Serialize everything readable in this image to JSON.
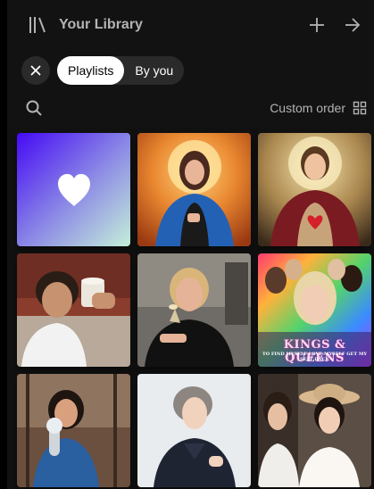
{
  "header": {
    "title": "Your Library",
    "library_icon": "library-icon",
    "create_icon": "plus-icon",
    "expand_icon": "arrow-right-icon"
  },
  "filters": {
    "clear_icon": "close-icon",
    "chips": [
      {
        "label": "Playlists",
        "active": true
      },
      {
        "label": "By you",
        "active": false
      }
    ]
  },
  "toolbar": {
    "search_icon": "search-icon",
    "sort_label": "Custom order",
    "view_icon": "grid-view-icon"
  },
  "grid": {
    "items": [
      {
        "kind": "liked-songs",
        "icon": "heart-icon"
      },
      {
        "kind": "artwork"
      },
      {
        "kind": "artwork"
      },
      {
        "kind": "artwork"
      },
      {
        "kind": "artwork"
      },
      {
        "kind": "artwork",
        "cover_text": "KINGS & QUEENS",
        "cover_subtext": "TO FIND MYSELF LOVE MYSELF GET MY SELF BACK"
      },
      {
        "kind": "artwork"
      },
      {
        "kind": "artwork"
      },
      {
        "kind": "artwork"
      }
    ]
  },
  "colors": {
    "background": "#121212",
    "chip_bg": "#2a2a2a",
    "chip_active_bg": "#ffffff",
    "muted_text": "#b3b3b3",
    "liked_gradient": [
      "#450af5",
      "#8e8ee5",
      "#c4efd9"
    ]
  }
}
